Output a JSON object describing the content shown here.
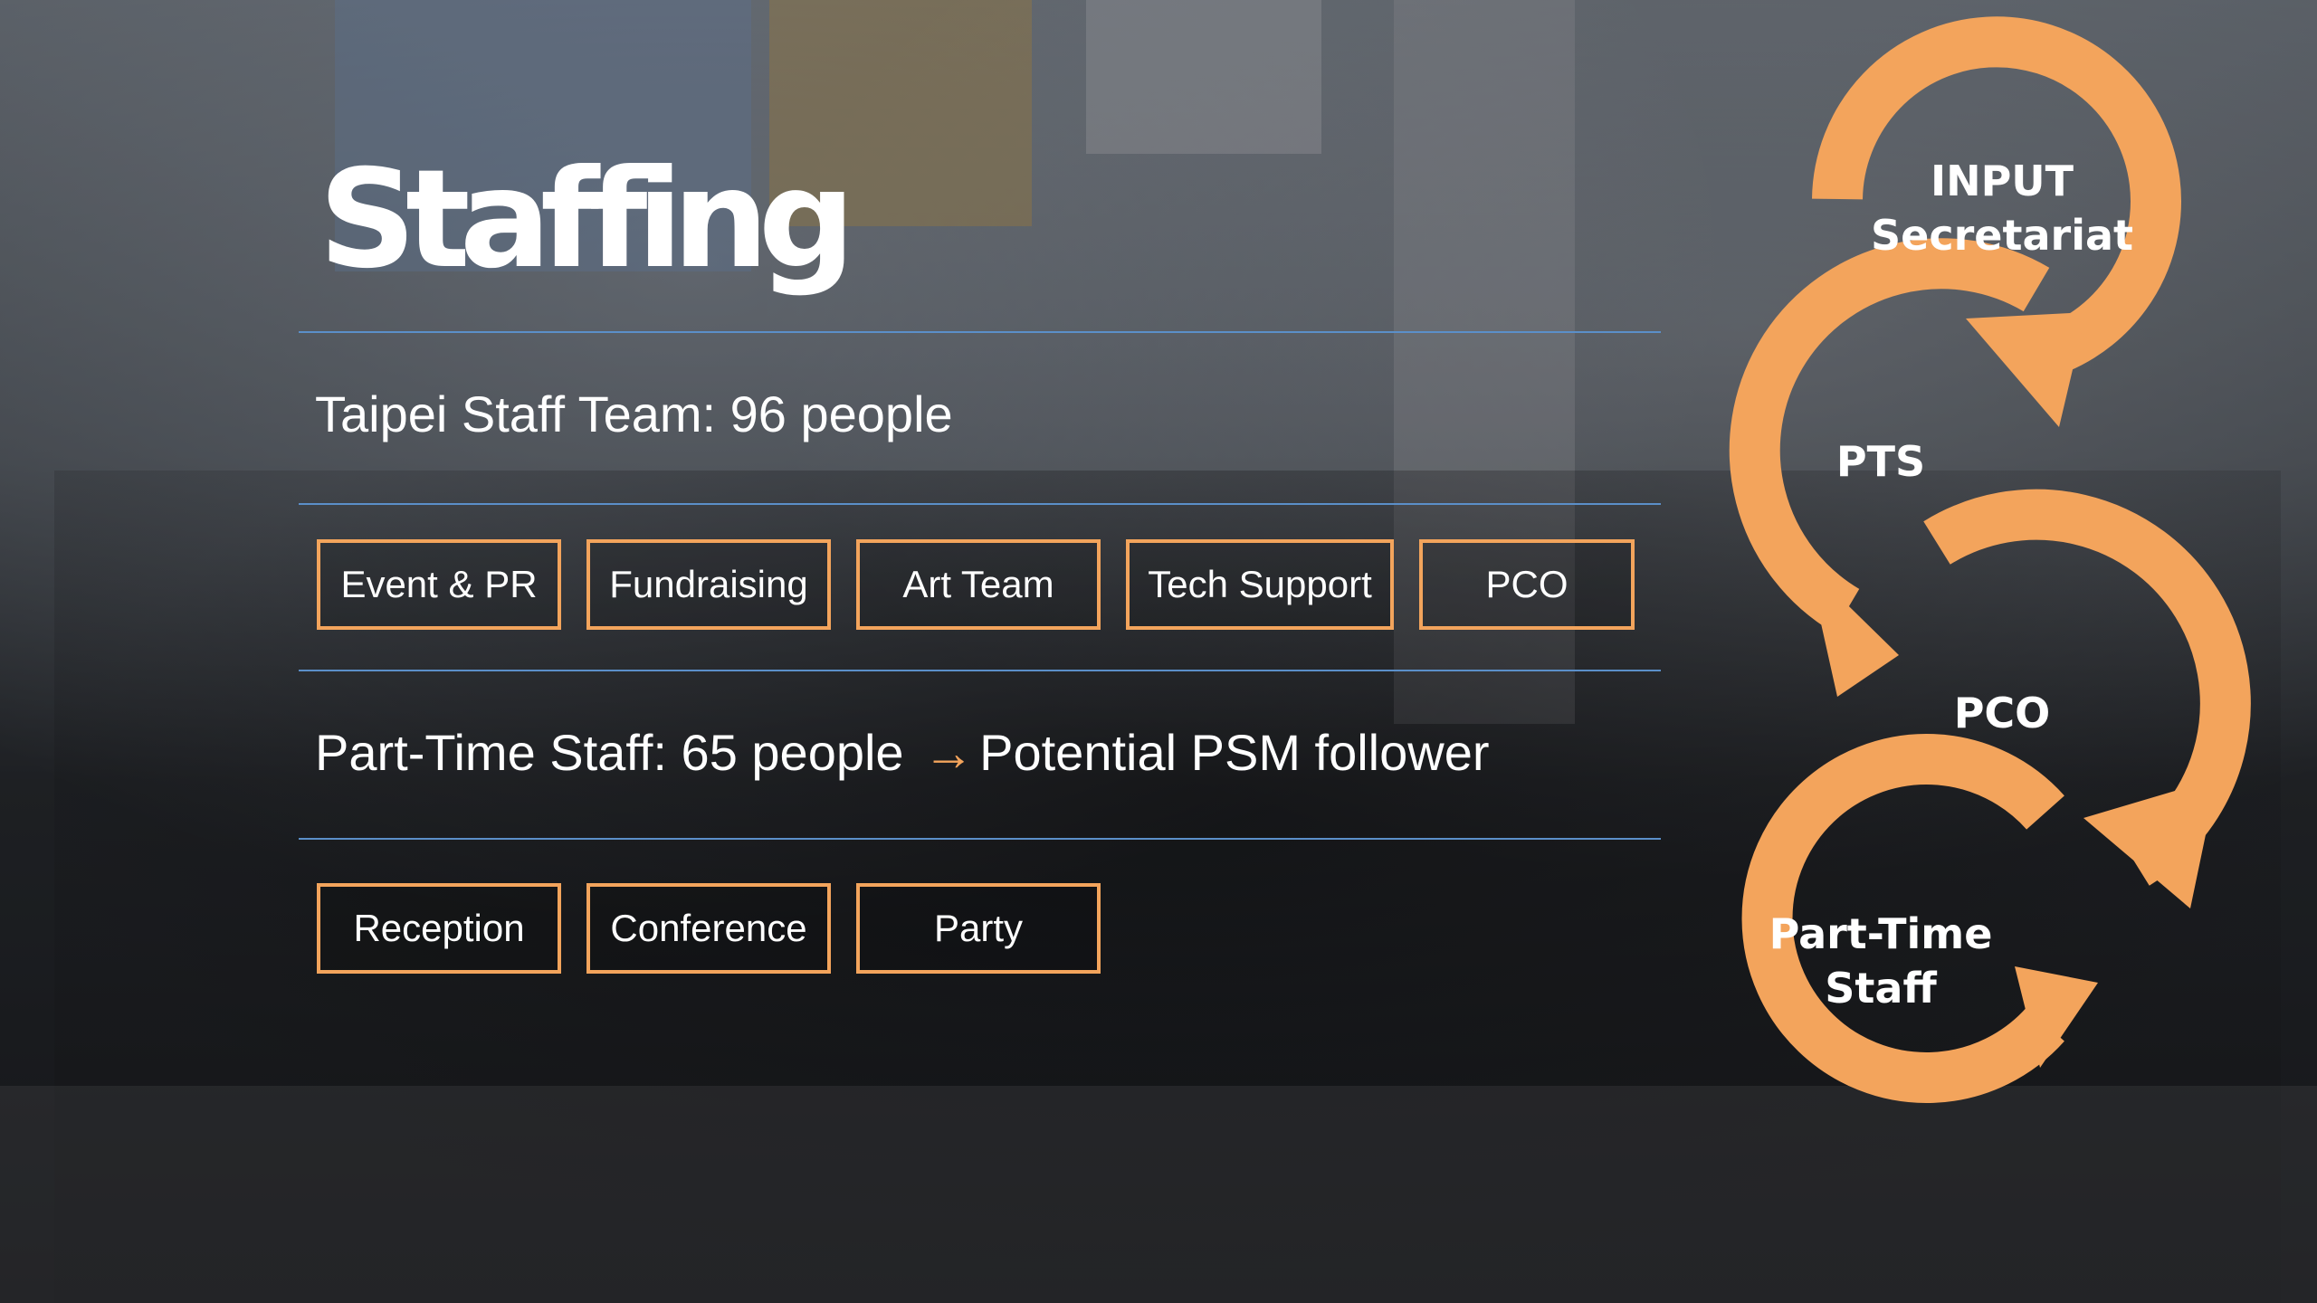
{
  "slide": {
    "title": "Staffing",
    "taipei_team": "Taipei Staff Team: 96 people",
    "part_time_prefix": "Part-Time Staff: 65 people",
    "part_time_suffix": "Potential PSM follower",
    "arrow_glyph": "→"
  },
  "team_tags": [
    {
      "label": "Event & PR"
    },
    {
      "label": "Fundraising"
    },
    {
      "label": "Art Team"
    },
    {
      "label": "Tech Support"
    },
    {
      "label": "PCO"
    }
  ],
  "part_time_tags": [
    {
      "label": "Reception"
    },
    {
      "label": "Conference"
    },
    {
      "label": "Party"
    }
  ],
  "cycle": {
    "input_line1": "INPUT",
    "input_line2": "Secretariat",
    "pts": "PTS",
    "pco": "PCO",
    "parttime_line1": "Part-Time",
    "parttime_line2": "Staff"
  },
  "colors": {
    "accent": "#f3a45c",
    "rule": "#5b8fc9",
    "text": "#ffffff"
  }
}
